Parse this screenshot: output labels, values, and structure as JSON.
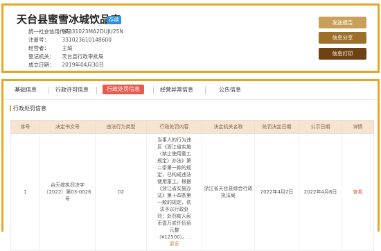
{
  "company": {
    "name": "天台县蜜雪冰城饮品店",
    "status_badge": "存续",
    "fields": [
      {
        "label": "统一社会信用代码：",
        "value": "92331023MA2DUJU25N"
      },
      {
        "label": "注册号：",
        "value": "331023610148600"
      },
      {
        "label": "经营者：",
        "value": "王琦"
      },
      {
        "label": "登记机关：",
        "value": "天台县行政审批局"
      },
      {
        "label": "成立日期：",
        "value": "2019年04月30日"
      }
    ]
  },
  "actions": {
    "send_report": "发送报告",
    "share": "信息分享",
    "print": "信息打印"
  },
  "tabs": [
    {
      "label": "基础信息"
    },
    {
      "label": "行政许可信息"
    },
    {
      "label": "行政处罚信息",
      "active": true
    },
    {
      "label": "经营异常信息"
    },
    {
      "label": "公告信息"
    }
  ],
  "section": {
    "title": "行政处罚信息"
  },
  "table": {
    "columns": [
      "序号",
      "决定书文号",
      "违法行为类型",
      "行政处罚内容",
      "决定机关名称",
      "处罚决定日期",
      "公示日期",
      "详情"
    ],
    "rows": [
      {
        "index": "1",
        "doc_number": "台天综执罚决字〔2022〕第03-0026号",
        "violation_type": "02",
        "content": "当事人的行为违反《浙江省实施〈禁止使用童工规定〉办法》第二条第一款的规定，已构成违法使用童工。根据《浙江省实施办法》第十四条第一款的规定，依法予以行政处罚：处罚款人民币壹万贰仟伍佰元整（¥12500）。",
        "more": "更多",
        "authority": "浙江省天台县综合行政执法局",
        "decision_date": "2022年4月2日",
        "publish_date": "2022年4月8日",
        "detail": "查看"
      }
    ]
  },
  "colors": {
    "frame": "#e6a623",
    "badge": "#2d8fe0",
    "tab_active": "#e85a50",
    "header_bg": "#f6e4d2",
    "btn_send": "#c8a05a",
    "btn_share": "#9c6f2a",
    "btn_print": "#6e4313"
  }
}
